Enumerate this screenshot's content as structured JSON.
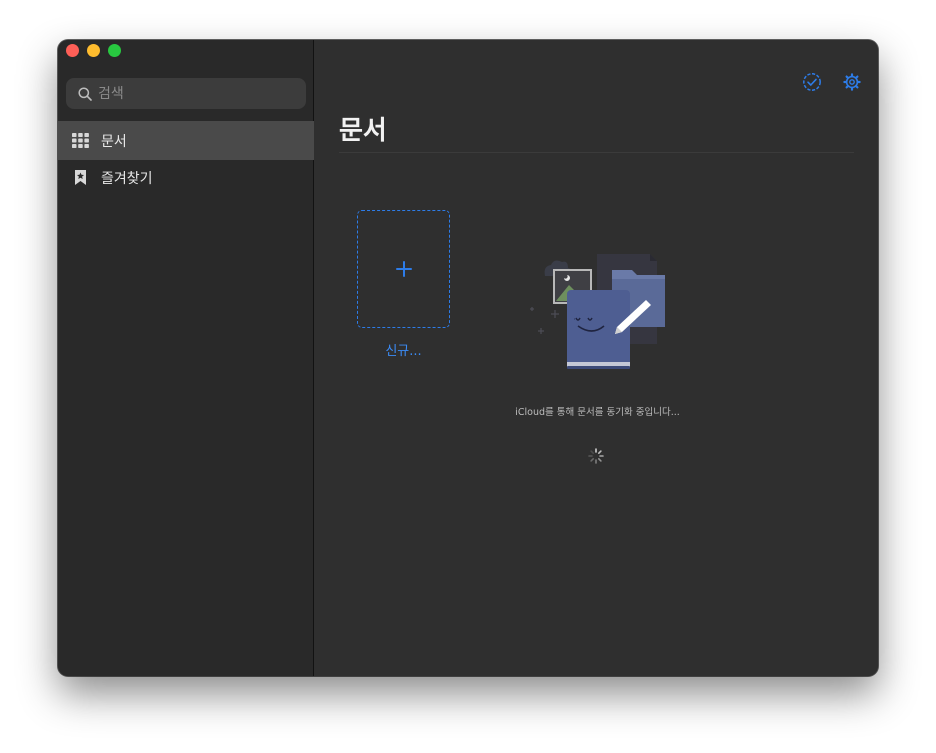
{
  "sidebar": {
    "search": {
      "placeholder": "검색",
      "value": ""
    },
    "items": [
      {
        "label": "문서",
        "icon": "grid-icon",
        "active": true
      },
      {
        "label": "즐겨찾기",
        "icon": "bookmark-star-icon",
        "active": false
      }
    ]
  },
  "main": {
    "title": "문서",
    "toolbar": {
      "select_icon": "checkmark-circle-icon",
      "settings_icon": "gear-icon"
    },
    "new_document": {
      "label": "신규..."
    },
    "sync": {
      "message": "iCloud를 통해 문서를 동기화 중입니다..."
    }
  },
  "colors": {
    "accent": "#2d7ce8",
    "sidebar_bg": "#292929",
    "main_bg": "#2f2f2f",
    "active_item": "#4a4a4a"
  }
}
